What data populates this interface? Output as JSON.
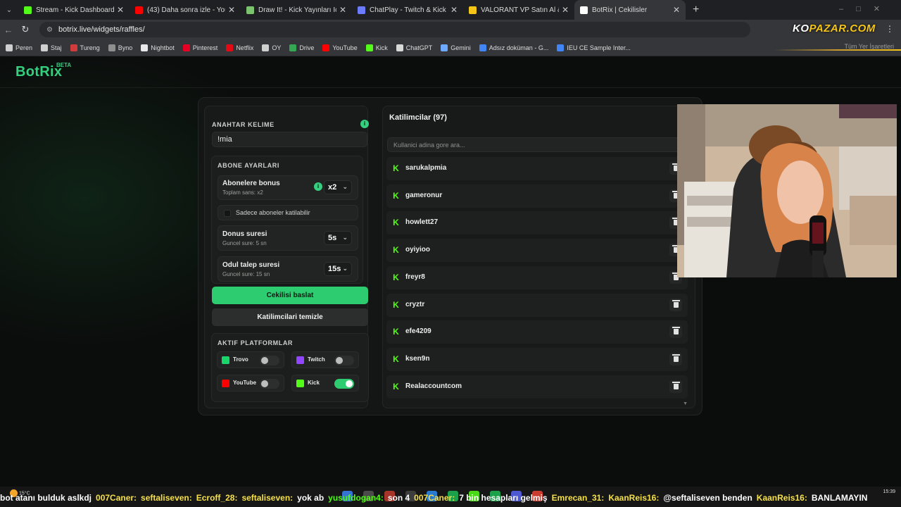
{
  "browser": {
    "tabs": [
      {
        "title": "Stream - Kick Dashboard",
        "icon": "kick-icon",
        "color": "#53fc18",
        "active": false
      },
      {
        "title": "(43) Daha sonra izle - YouTube",
        "icon": "youtube-icon",
        "color": "#ff0000",
        "active": false
      },
      {
        "title": "Draw It! - Kick Yayınları İçin Çiz",
        "icon": "draw-icon",
        "color": "#7cc36e",
        "active": false
      },
      {
        "title": "ChatPlay - Twitch & Kick İzleyic",
        "icon": "chatplay-icon",
        "color": "#6b7cff",
        "active": false
      },
      {
        "title": "VALORANT VP Satın Al & VP Fi",
        "icon": "valorant-icon",
        "color": "#f5c518",
        "active": false
      },
      {
        "title": "BotRix | Cekilisler",
        "icon": "botrix-icon",
        "color": "#ffffff",
        "active": true
      }
    ],
    "url": "botrix.live/widgets/raffles/",
    "bookmarks": [
      {
        "label": "Peren",
        "icon": "folder-icon",
        "color": "#cfcfcf"
      },
      {
        "label": "Staj",
        "icon": "folder-icon",
        "color": "#cfcfcf"
      },
      {
        "label": "Tureng",
        "icon": "tureng-icon",
        "color": "#d23b3b"
      },
      {
        "label": "Byno",
        "icon": "byno-icon",
        "color": "#8f8f8f"
      },
      {
        "label": "Nightbot",
        "icon": "nightbot-icon",
        "color": "#e9e9e9"
      },
      {
        "label": "Pinterest",
        "icon": "pinterest-icon",
        "color": "#e60023"
      },
      {
        "label": "Netflix",
        "icon": "netflix-icon",
        "color": "#e50914"
      },
      {
        "label": "OY",
        "icon": "folder-icon",
        "color": "#cfcfcf"
      },
      {
        "label": "Drive",
        "icon": "drive-icon",
        "color": "#34a853"
      },
      {
        "label": "YouTube",
        "icon": "youtube-icon",
        "color": "#ff0000"
      },
      {
        "label": "Kick",
        "icon": "kick-icon",
        "color": "#53fc18"
      },
      {
        "label": "ChatGPT",
        "icon": "chatgpt-icon",
        "color": "#d9d9d9"
      },
      {
        "label": "Gemini",
        "icon": "gemini-icon",
        "color": "#6ea8ff"
      },
      {
        "label": "Adsız doküman - G...",
        "icon": "docs-icon",
        "color": "#4285f4"
      },
      {
        "label": "IEU CE Sample Inter...",
        "icon": "docs-icon",
        "color": "#4285f4"
      }
    ],
    "all_bookmarks": "Tüm Yer İşaretleri",
    "overlay_logo": {
      "text_a": "KO",
      "text_b": "PAZAR",
      "text_c": ".COM"
    }
  },
  "botrix": {
    "logo": "BotRix",
    "beta": "BETA",
    "keyword": {
      "label": "ANAHTAR KELIME",
      "value": "!mia"
    },
    "subscriber": {
      "section": "ABONE AYARLARI",
      "bonus": {
        "title": "Abonelere bonus",
        "sub": "Toplam sans: x2",
        "value": "x2"
      },
      "only_subs": "Sadece aboneler katilabilir",
      "spin": {
        "title": "Donus suresi",
        "sub": "Guncel sure: 5 sn",
        "value": "5s"
      },
      "claim": {
        "title": "Odul talep suresi",
        "sub": "Guncel sure: 15 sn",
        "value": "15s"
      }
    },
    "start_button": "Cekilisi baslat",
    "clear_button": "Katilimcilari temizle",
    "platforms": {
      "section": "AKTIF PLATFORMLAR",
      "items": [
        {
          "name": "Trovo",
          "enabled": false,
          "color": "#19d66b"
        },
        {
          "name": "Twitch",
          "enabled": false,
          "color": "#9146ff"
        },
        {
          "name": "YouTube",
          "enabled": false,
          "color": "#ff0000"
        },
        {
          "name": "Kick",
          "enabled": true,
          "color": "#53fc18"
        }
      ]
    },
    "participants": {
      "title": "Katilimcilar (97)",
      "search_placeholder": "Kullanici adina gore ara...",
      "list": [
        "sarukalpmia",
        "gameronur",
        "howlett27",
        "oyiyioo",
        "freyr8",
        "cryztr",
        "efe4209",
        "ksen9n",
        "Realaccountcom"
      ]
    }
  },
  "taskbar": {
    "weather": "15°C",
    "time": "15:39",
    "chat": [
      {
        "user": "",
        "msg": "bot atanı bulduk aslkdj"
      },
      {
        "user": "007Caner:",
        "msg": ""
      },
      {
        "user": "seftaliseven:",
        "msg": ""
      },
      {
        "user": "Ecroff_28:",
        "msg": ""
      },
      {
        "user": "seftaliseven:",
        "msg": "yok ab"
      },
      {
        "user": "yusufdogan4:",
        "msg": "son 4"
      },
      {
        "user": "007Caner:",
        "msg": "7 bin hesapları gelmiş"
      },
      {
        "user": "Emrecan_31:",
        "msg": ""
      },
      {
        "user": "KaanReis16:",
        "msg": "@seftaliseven benden"
      },
      {
        "user": "KaanReis16:",
        "msg": "BANLAMAYIN"
      }
    ]
  }
}
